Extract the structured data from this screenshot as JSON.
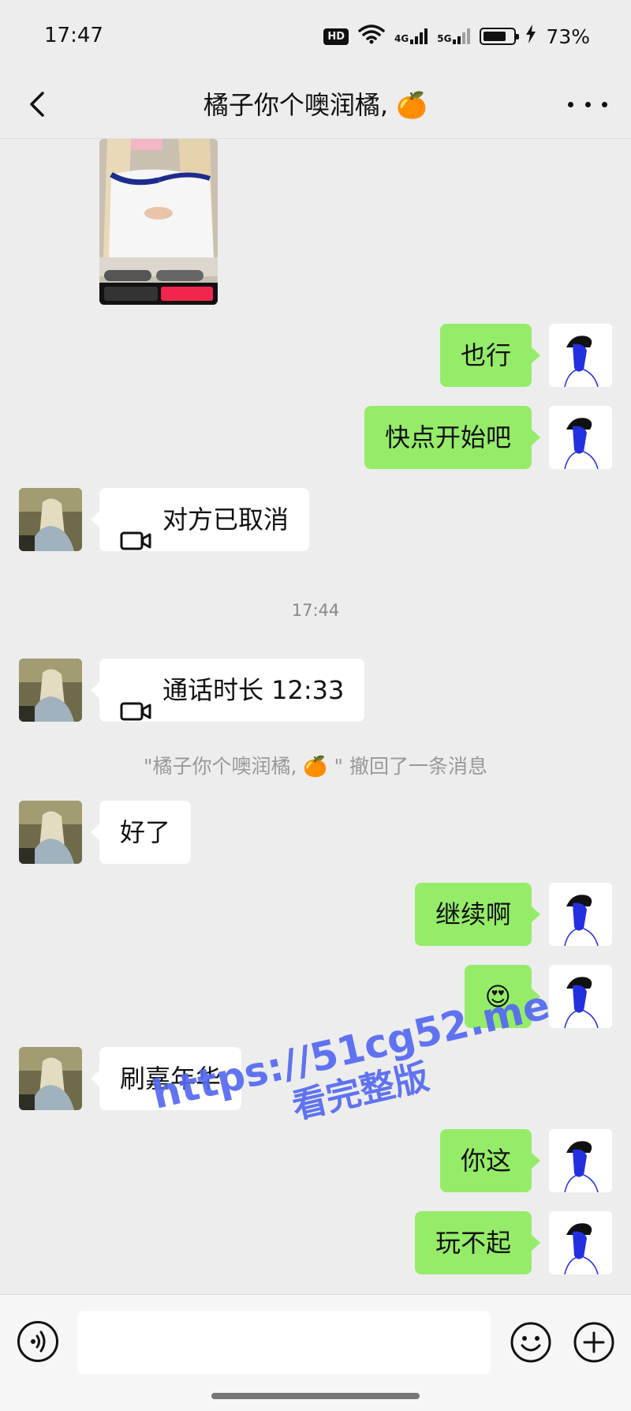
{
  "status_bar": {
    "time": "17:47",
    "hd_badge": "HD",
    "net1": "4G",
    "net2": "5G",
    "battery": "73%"
  },
  "nav": {
    "title": "橘子你个噢润橘, 🍊",
    "back_icon": "chevron-left-icon",
    "more_icon": "more-dots-icon"
  },
  "messages": [
    {
      "side": "in",
      "type": "image"
    },
    {
      "side": "out",
      "type": "text",
      "text": "也行"
    },
    {
      "side": "out",
      "type": "text",
      "text": "快点开始吧"
    },
    {
      "side": "in",
      "type": "call",
      "text": "对方已取消"
    },
    {
      "type": "time",
      "text": "17:44"
    },
    {
      "side": "in",
      "type": "call",
      "text": "通话时长 12:33"
    },
    {
      "type": "system",
      "text": "\"橘子你个噢润橘, 🍊 \" 撤回了一条消息"
    },
    {
      "side": "in",
      "type": "text",
      "text": "好了"
    },
    {
      "side": "out",
      "type": "text",
      "text": "继续啊"
    },
    {
      "side": "out",
      "type": "text",
      "text": "😍"
    },
    {
      "side": "in",
      "type": "text",
      "text": "刷嘉年华"
    },
    {
      "side": "out",
      "type": "text",
      "text": "你这"
    },
    {
      "side": "out",
      "type": "text",
      "text": "玩不起"
    }
  ],
  "watermark": {
    "url": "https://51cg52.me",
    "subtitle": "看完整版"
  },
  "input_bar": {
    "placeholder": "",
    "voice_icon": "voice-icon",
    "emoji_icon": "emoji-icon",
    "plus_icon": "plus-icon"
  },
  "colors": {
    "background": "#ededed",
    "outgoing_bubble": "#95ec69",
    "incoming_bubble": "#ffffff",
    "watermark": "#5469f2"
  }
}
